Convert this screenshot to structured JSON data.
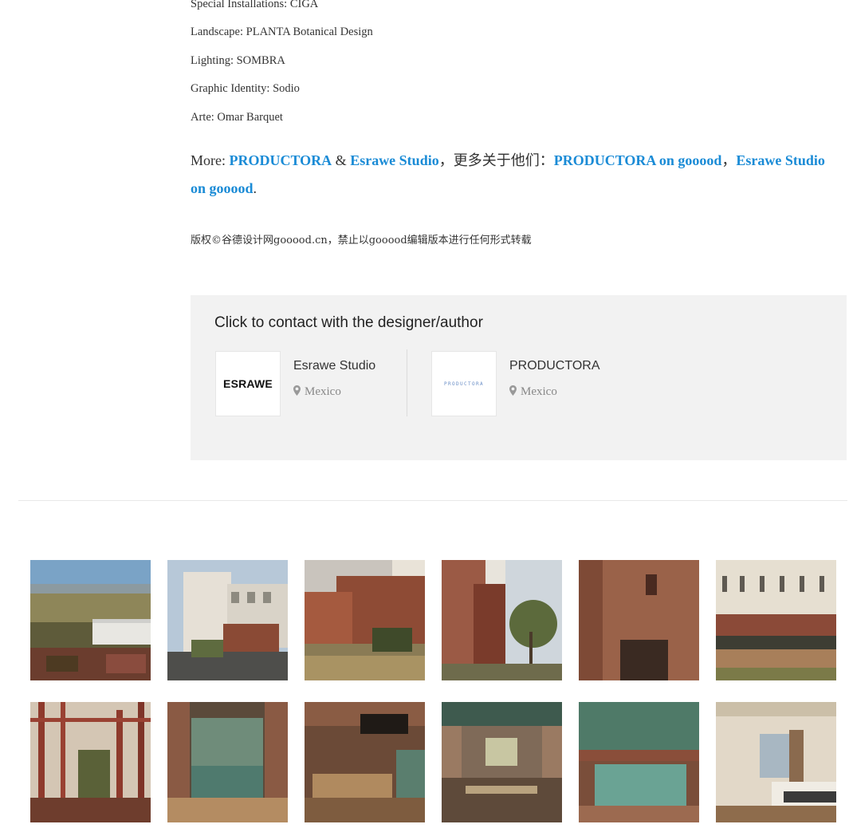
{
  "credits": [
    "Special Installations: CIGA",
    "Landscape: PLANTA Botanical Design",
    "Lighting: SOMBRA",
    "Graphic Identity: Sodio",
    "Arte: Omar Barquet"
  ],
  "more": {
    "prefix": "More: ",
    "link1": "PRODUCTORA",
    "amp": " & ",
    "link2": "Esrawe Studio",
    "middle": "，更多关于他们：",
    "link3": "PRODUCTORA on gooood",
    "comma": "，",
    "link4": "Esrawe Studio on gooood",
    "suffix": "."
  },
  "copyright": "版权©谷德设计网gooood.cn，禁止以gooood编辑版本进行任何形式转载",
  "contact": {
    "title": "Click to contact with the designer/author",
    "designers": [
      {
        "name": "Esrawe Studio",
        "location": "Mexico",
        "logo_text": "ESRAWE",
        "icon": "map-pin-icon"
      },
      {
        "name": "PRODUCTORA",
        "location": "Mexico",
        "logo_text": "PRODUCTORA",
        "icon": "map-pin-icon"
      }
    ]
  },
  "gallery": {
    "count": 12,
    "subjects": [
      "aerial-landscape",
      "white-building-exterior",
      "brick-cube-with-plants",
      "brick-tower-with-tree",
      "brick-facade-closeup",
      "hotel-facade-terraces",
      "red-lattice-courtyard",
      "green-tile-lobby",
      "lounge-interior",
      "restaurant-interior",
      "green-tile-bar",
      "hotel-bedroom"
    ]
  },
  "colors": {
    "link": "#1a8bd6",
    "contact_bg": "#f2f2f2",
    "text": "#333333",
    "muted": "#888888"
  }
}
